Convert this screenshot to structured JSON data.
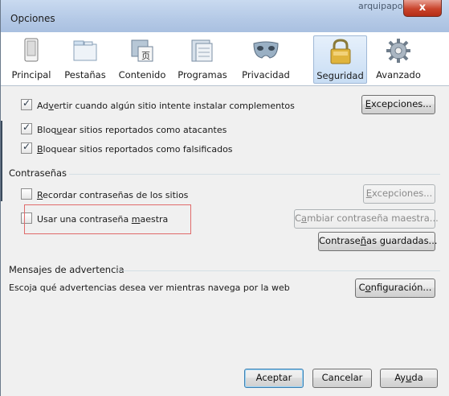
{
  "window": {
    "title": "Opciones",
    "background_title_text": "arquipapo",
    "close_glyph": "x"
  },
  "tabs": [
    {
      "label": "Principal",
      "icon": "window-icon"
    },
    {
      "label": "Pestañas",
      "icon": "tabs-icon"
    },
    {
      "label": "Contenido",
      "icon": "content-icon"
    },
    {
      "label": "Programas",
      "icon": "programs-icon"
    },
    {
      "label": "Privacidad",
      "icon": "mask-icon"
    },
    {
      "label": "Seguridad",
      "icon": "lock-icon"
    },
    {
      "label": "Avanzado",
      "icon": "gear-icon"
    }
  ],
  "active_tab": "Seguridad",
  "security": {
    "warn_addons": {
      "pre": "Ad",
      "u": "v",
      "post": "ertir cuando algún sitio intente instalar complementos",
      "checked": true
    },
    "exceptions_btn": {
      "pre": "",
      "u": "E",
      "post": "xcepciones..."
    },
    "block_attack": {
      "pre": "Bloq",
      "u": "u",
      "post": "ear sitios reportados como atacantes",
      "checked": true
    },
    "block_forgery": {
      "pre": "",
      "u": "B",
      "post": "loquear sitios reportados como falsificados",
      "checked": true
    }
  },
  "passwords": {
    "section_title": "Contraseñas",
    "remember": {
      "pre": "",
      "u": "R",
      "post": "ecordar contraseñas de los sitios",
      "checked": false
    },
    "exceptions_btn": {
      "pre": "",
      "u": "E",
      "post": "xcepciones..."
    },
    "master": {
      "pre": "Usar una contraseña ",
      "u": "m",
      "post": "aestra",
      "checked": false
    },
    "change_master_btn": {
      "pre": "C",
      "u": "a",
      "post": "mbiar contraseña maestra..."
    },
    "saved_btn": {
      "pre": "Contrase",
      "u": "ñ",
      "post": "as guardadas..."
    }
  },
  "warnings": {
    "section_title": "Mensajes de advertencia",
    "description": "Escoja qué advertencias desea ver mientras navega por la web",
    "config_btn": {
      "pre": "C",
      "u": "o",
      "post": "nfiguración..."
    }
  },
  "footer": {
    "accept": "Aceptar",
    "cancel": "Cancelar",
    "help": {
      "pre": "Ay",
      "u": "u",
      "post": "da"
    }
  },
  "colors": {
    "highlight_box": "#e06b6b",
    "close_button": "#c9442c",
    "active_tab_bg": "#c8ddf4"
  }
}
